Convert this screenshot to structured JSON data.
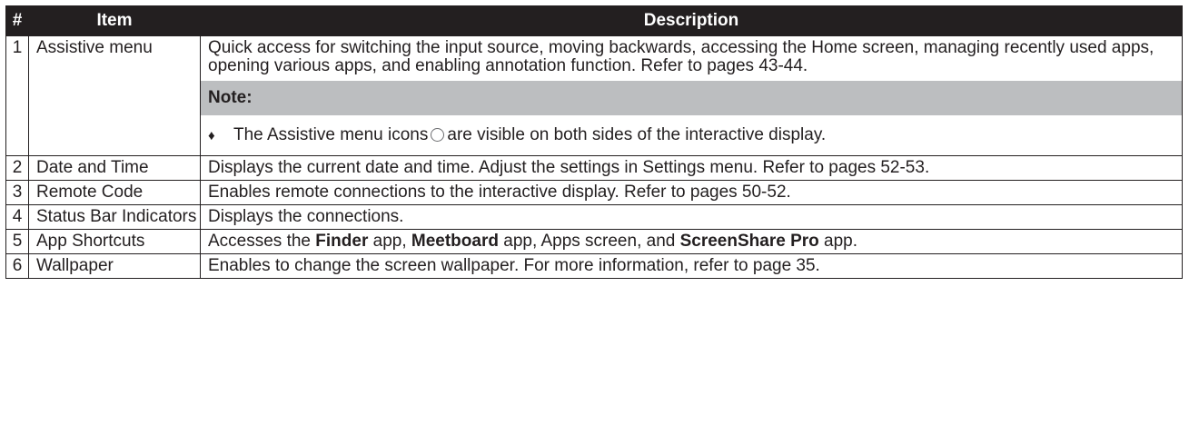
{
  "table": {
    "headers": {
      "num": "#",
      "item": "Item",
      "description": "Description"
    },
    "rows": [
      {
        "num": "1",
        "item": "Assistive menu",
        "description": "Quick access for switching the input source, moving backwards, accessing the Home screen, managing recently used apps, opening various apps, and enabling annotation function. Refer to pages 43-44.",
        "note_label": "Note:",
        "note_bullet": "♦",
        "note_text_before": "The Assistive menu icons",
        "note_icon": "circle-icon",
        "note_text_after": "are visible on both sides of the interactive display."
      },
      {
        "num": "2",
        "item": "Date and Time",
        "description": "Displays the current date and time. Adjust the settings in Settings menu. Refer to pages 52-53."
      },
      {
        "num": "3",
        "item": "Remote Code",
        "description": "Enables remote connections to the interactive display. Refer to pages 50-52."
      },
      {
        "num": "4",
        "item": "Status Bar Indicators",
        "description": "Displays the connections."
      },
      {
        "num": "5",
        "item": "App Shortcuts",
        "description_parts": [
          "Accesses the ",
          "Finder",
          " app, ",
          "Meetboard",
          " app, Apps screen, and ",
          "ScreenShare Pro",
          " app."
        ]
      },
      {
        "num": "6",
        "item": "Wallpaper",
        "description": "Enables to change the screen wallpaper. For more information, refer to page 35."
      }
    ]
  },
  "colors": {
    "header_bg": "#231f20",
    "header_text": "#ffffff",
    "note_band": "#bcbec0",
    "text": "#231f20"
  }
}
